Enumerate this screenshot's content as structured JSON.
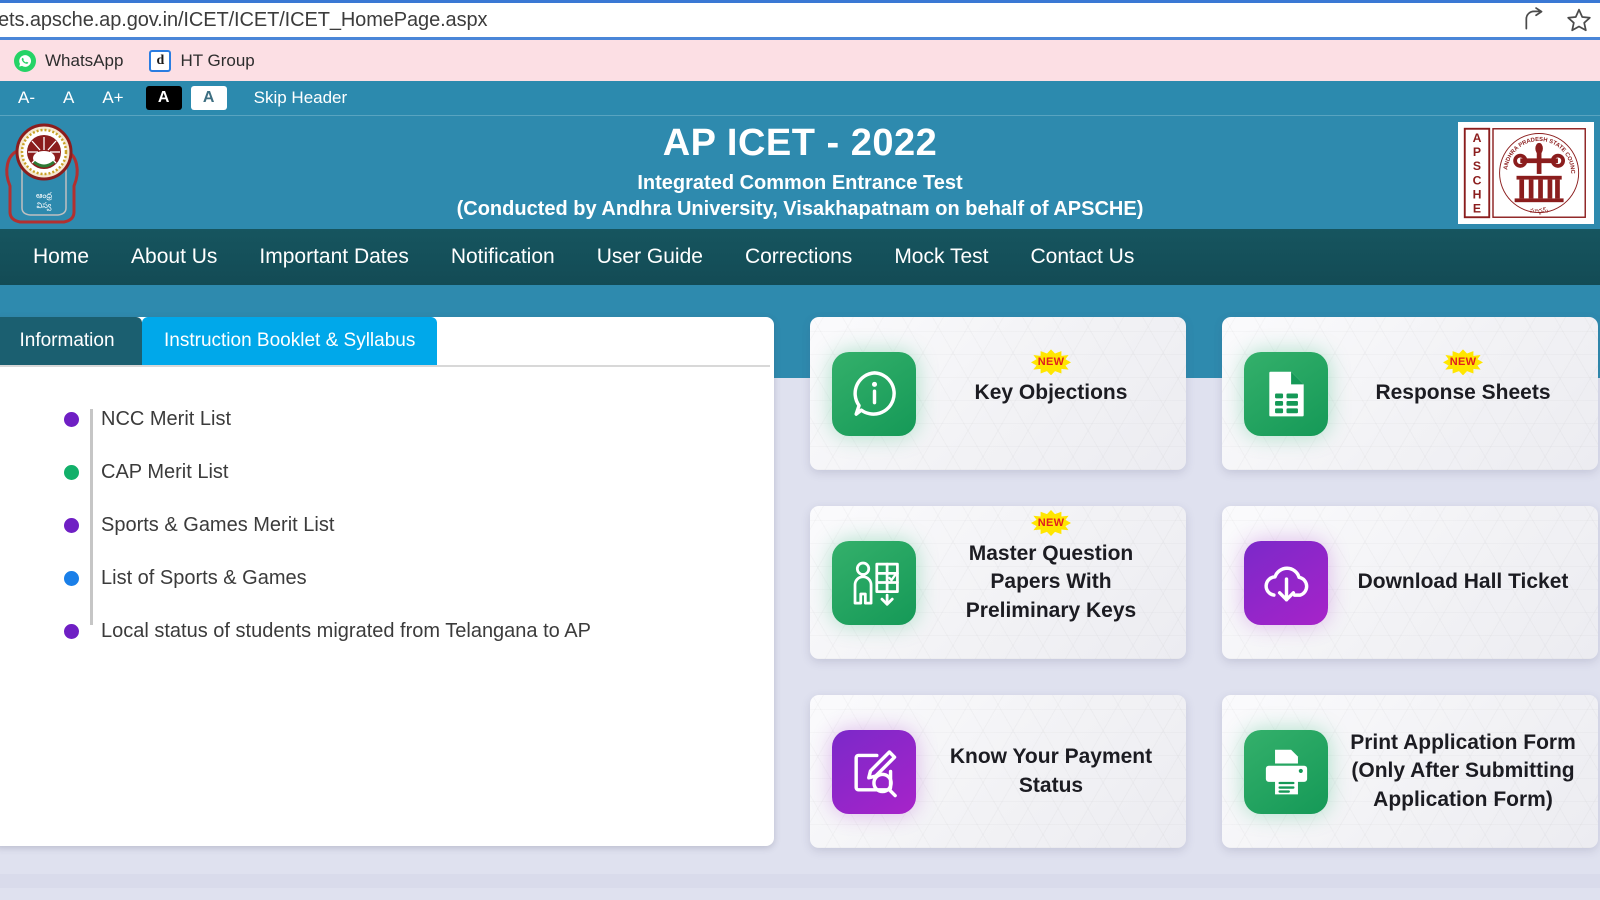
{
  "browser": {
    "url": "ets.apsche.ap.gov.in/ICET/ICET/ICET_HomePage.aspx",
    "share_icon": "share-icon",
    "bookmark_icon": "star-icon",
    "bookmarks": [
      {
        "label": "WhatsApp",
        "icon": "whatsapp-icon"
      },
      {
        "label": "HT Group",
        "icon": "ht-group-icon",
        "glyph": "d"
      }
    ]
  },
  "accessibility": {
    "decrease": "A-",
    "normal": "A",
    "increase": "A+",
    "contrast_dark": "A",
    "contrast_light": "A",
    "skip_header": "Skip Header"
  },
  "header": {
    "title": "AP ICET - 2022",
    "subtitle1": "Integrated Common Entrance Test",
    "subtitle2": "(Conducted by Andhra University, Visakhapatnam on behalf of APSCHE)",
    "left_logo": "andhra-university-emblem",
    "right_logo": "apsche-logo",
    "apsche_vertical": "APSCHE",
    "apsche_ring_text": "ANDHRA PRADESH STATE COUNCIL OF HIGHER EDUCATION"
  },
  "nav": {
    "items": [
      {
        "label": "Home"
      },
      {
        "label": "About Us"
      },
      {
        "label": "Important Dates"
      },
      {
        "label": "Notification"
      },
      {
        "label": "User Guide"
      },
      {
        "label": "Corrections"
      },
      {
        "label": "Mock Test"
      },
      {
        "label": "Contact Us"
      }
    ]
  },
  "left_panel": {
    "tabs": [
      {
        "label": "Information",
        "active": false
      },
      {
        "label": "Instruction Booklet & Syllabus",
        "active": true
      }
    ],
    "items": [
      {
        "label": "NCC Merit List",
        "bullet_color": "#6f1fc4"
      },
      {
        "label": "CAP Merit List",
        "bullet_color": "#12b06a"
      },
      {
        "label": "Sports & Games Merit List",
        "bullet_color": "#6f1fc4"
      },
      {
        "label": "List of Sports & Games",
        "bullet_color": "#1a7fe8"
      },
      {
        "label": "Local status of students migrated from Telangana to AP",
        "bullet_color": "#6f1fc4"
      }
    ]
  },
  "cards": [
    {
      "lines": [
        "Key Objections"
      ],
      "icon": "info-chat-bubble-icon",
      "icon_style": "green",
      "badge": "NEW"
    },
    {
      "lines": [
        "Response Sheets"
      ],
      "icon": "response-sheet-document-icon",
      "icon_style": "green",
      "badge": "NEW"
    },
    {
      "lines": [
        "Master Question",
        "Papers With",
        "Preliminary Keys"
      ],
      "icon": "question-paper-download-icon",
      "icon_style": "green",
      "badge": "NEW"
    },
    {
      "lines": [
        "Download Hall Ticket"
      ],
      "icon": "cloud-download-icon",
      "icon_style": "purple",
      "badge": ""
    },
    {
      "lines": [
        "Know Your Payment",
        "Status"
      ],
      "icon": "edit-search-icon",
      "icon_style": "purple",
      "badge": ""
    },
    {
      "lines": [
        "Print Application Form",
        "(Only After Submitting",
        "Application Form)"
      ],
      "icon": "printer-icon",
      "icon_style": "green",
      "badge": ""
    }
  ],
  "colors": {
    "teal": "#2e8aae",
    "nav_dark": "#134b55",
    "tab_active": "#00a8ea",
    "tab_inactive": "#1b5f70",
    "page_bg": "#dfe1ef",
    "bookmark_bar": "#fcdfe4",
    "green_icon": "#159957",
    "purple_icon": "#a723c9",
    "badge_yellow": "#ffe600",
    "badge_red": "#e02020"
  }
}
